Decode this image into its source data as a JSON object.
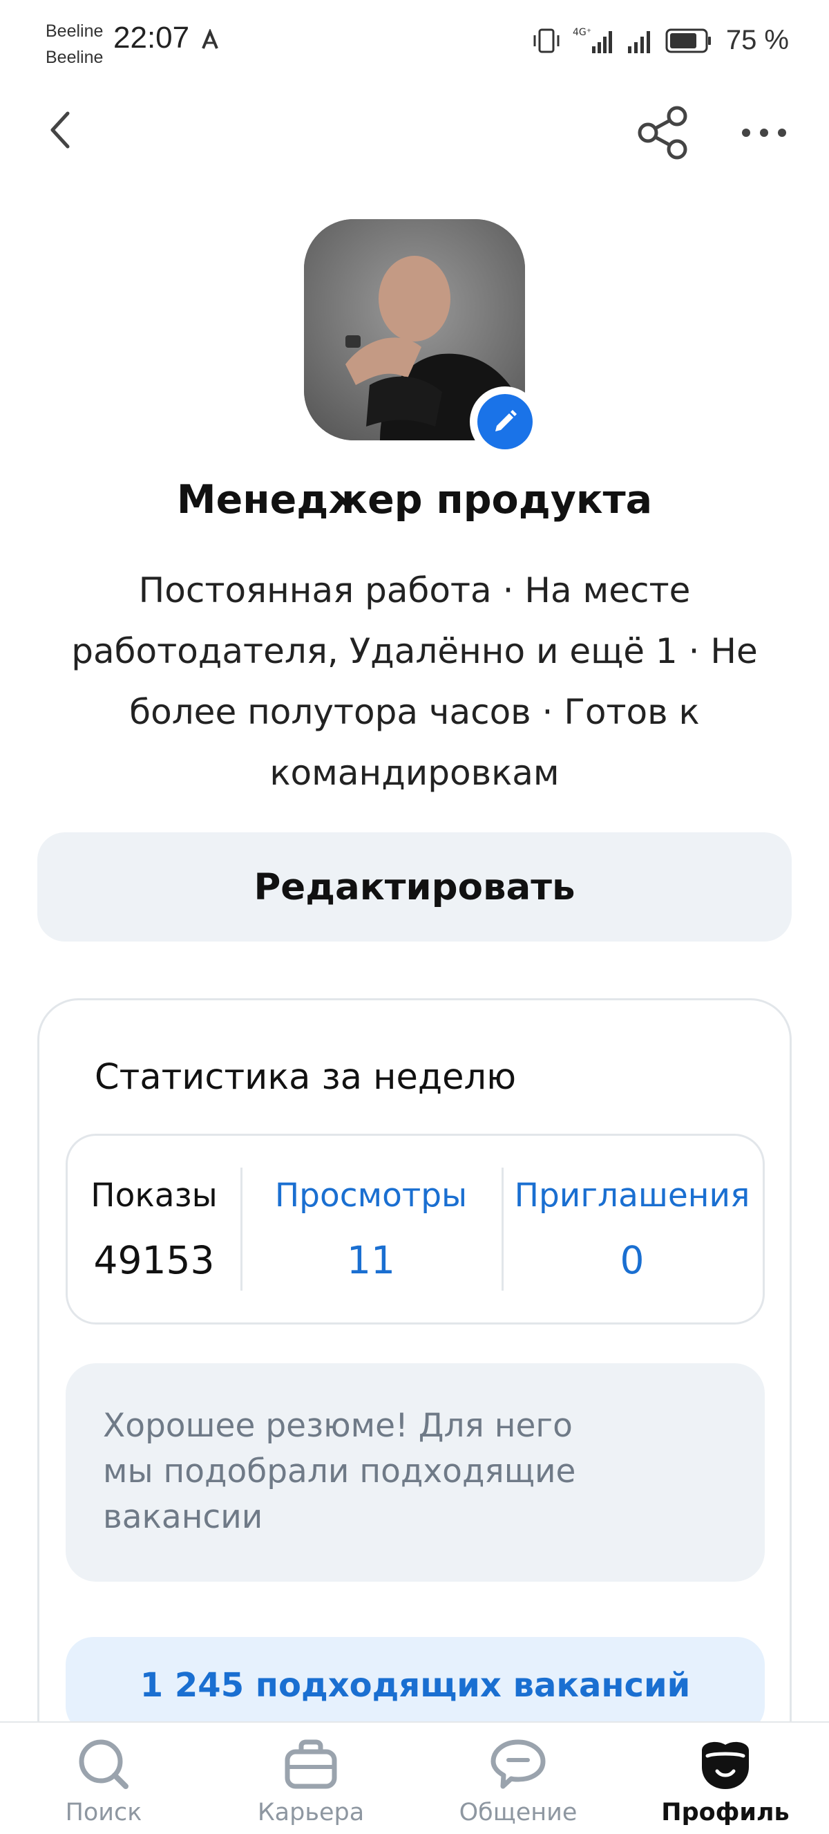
{
  "status_bar": {
    "carrier_1": "Beeline",
    "carrier_2": "Beeline",
    "time": "22:07",
    "network": "4G⁺",
    "battery": "75 %"
  },
  "profile": {
    "title": "Менеджер продукта",
    "description": "Постоянная работа · На месте работодателя, Удалённо и ещё 1 · Не более полутора часов · Готов к командировкам",
    "edit_button": "Редактировать"
  },
  "stats": {
    "title": "Статистика за неделю",
    "items": [
      {
        "label": "Показы",
        "value": "49153"
      },
      {
        "label": "Просмотры",
        "value": "11"
      },
      {
        "label": "Приглашения",
        "value": "0"
      }
    ],
    "hint": "Хорошее резюме! Для него мы подобрали подходящие вакансии",
    "vacancies_button": "1 245 подходящих вакансий"
  },
  "tabs": [
    {
      "label": "Поиск",
      "icon": "search-icon"
    },
    {
      "label": "Карьера",
      "icon": "briefcase-icon"
    },
    {
      "label": "Общение",
      "icon": "chat-icon"
    },
    {
      "label": "Профиль",
      "icon": "profile-icon",
      "active": true
    }
  ],
  "colors": {
    "accent": "#1a6fd1",
    "edit_badge": "#1a73e8",
    "surface": "#eef2f6"
  }
}
